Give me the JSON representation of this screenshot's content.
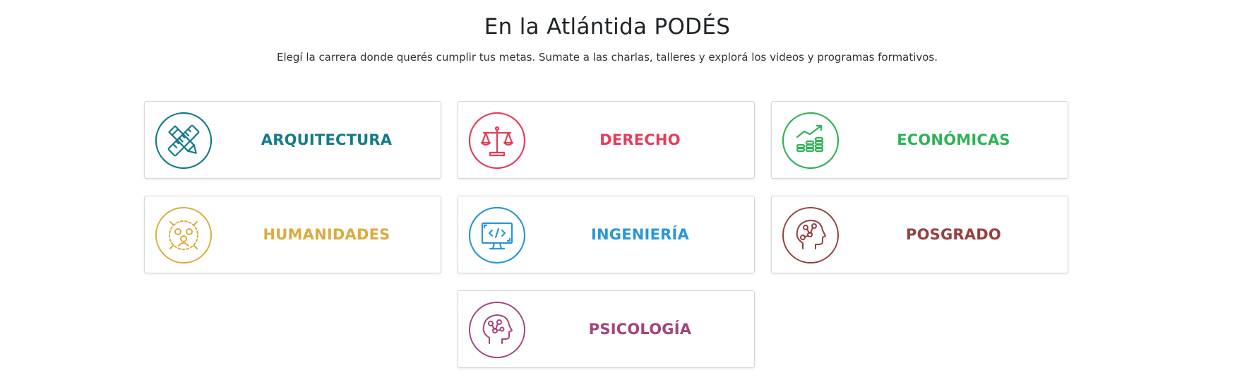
{
  "heading": {
    "title": "En la Atlántida PODÉS",
    "subtitle": "Elegí la carrera donde querés cumplir tus metas. Sumate a las charlas, talleres y explorá los videos y programas formativos."
  },
  "careers": [
    {
      "label": "ARQUITECTURA",
      "icon": "pencil-ruler-icon",
      "color": "#157a8a"
    },
    {
      "label": "DERECHO",
      "icon": "scales-icon",
      "color": "#e43d5a"
    },
    {
      "label": "ECONÓMICAS",
      "icon": "growth-coins-icon",
      "color": "#2eb356"
    },
    {
      "label": "HUMANIDADES",
      "icon": "people-network-icon",
      "color": "#dcaa3f"
    },
    {
      "label": "INGENIERÍA",
      "icon": "code-monitor-icon",
      "color": "#2a97d6"
    },
    {
      "label": "POSGRADO",
      "icon": "head-network-icon",
      "color": "#96403f"
    },
    {
      "label": "PSICOLOGÍA",
      "icon": "mind-head-icon",
      "color": "#a2447f"
    }
  ]
}
